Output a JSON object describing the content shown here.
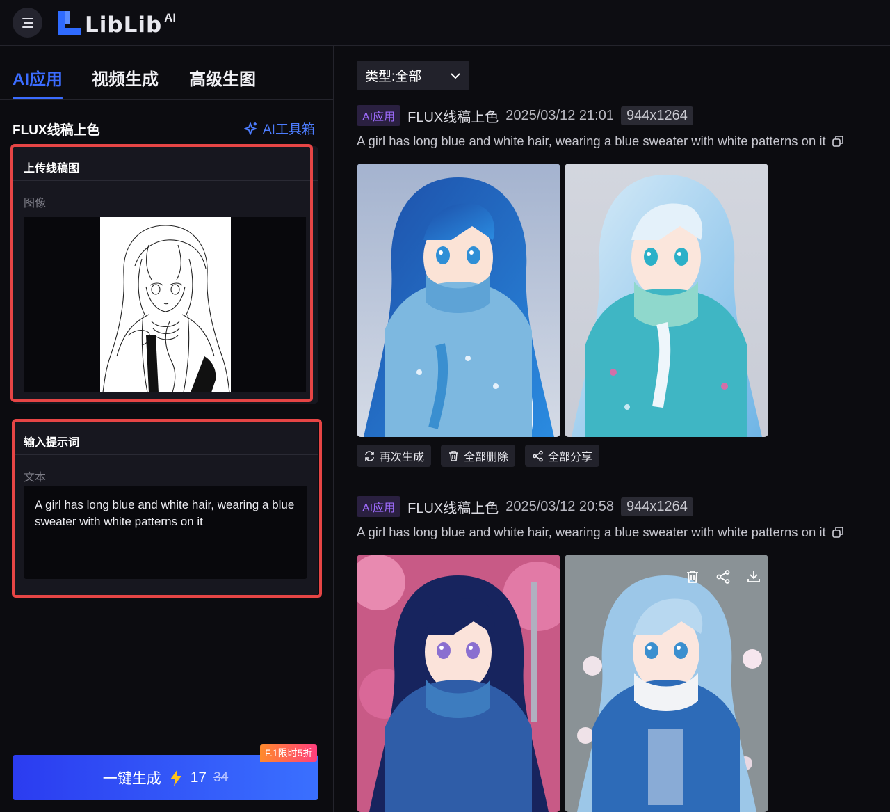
{
  "header": {
    "logo_text": "LibLib",
    "logo_sup": "AI",
    "menu_icon": "menu-icon"
  },
  "tabs": [
    {
      "label": "AI应用",
      "active": true
    },
    {
      "label": "视频生成",
      "active": false
    },
    {
      "label": "高级生图",
      "active": false
    }
  ],
  "app": {
    "title": "FLUX线稿上色",
    "toolbox_label": "AI工具箱"
  },
  "upload": {
    "title": "上传线稿图",
    "sub": "图像"
  },
  "prompt": {
    "title": "输入提示词",
    "sub": "文本",
    "value": "A girl has long blue and white hair, wearing a blue sweater with white patterns on it"
  },
  "generate": {
    "label": "一键生成",
    "cost": "17",
    "old_cost": "34",
    "promo": "F.1限时5折"
  },
  "filter": {
    "label": "类型:全部"
  },
  "records": [
    {
      "tag": "AI应用",
      "name": "FLUX线稿上色",
      "time": "2025/03/12 21:01",
      "dims": "944x1264",
      "prompt": "A girl has long blue and white hair, wearing a blue sweater with white patterns on it",
      "actions": [
        "再次生成",
        "全部删除",
        "全部分享"
      ]
    },
    {
      "tag": "AI应用",
      "name": "FLUX线稿上色",
      "time": "2025/03/12 20:58",
      "dims": "944x1264",
      "prompt": "A girl has long blue and white hair, wearing a blue sweater with white patterns on it"
    }
  ],
  "colors": {
    "accent": "#3b6cff",
    "highlight": "#e64545",
    "tag": "#a06cff"
  }
}
